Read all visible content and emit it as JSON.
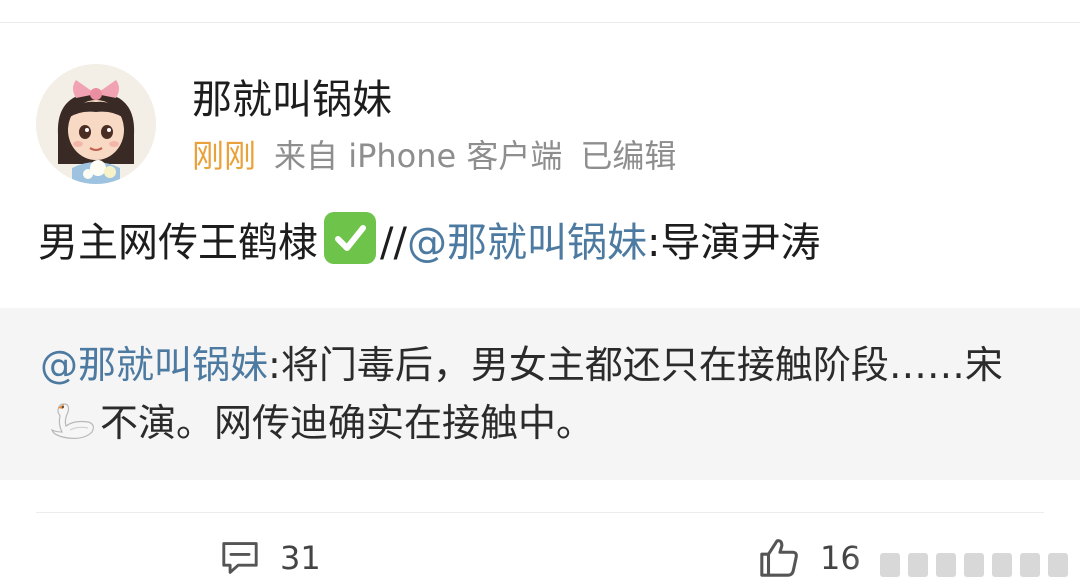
{
  "post": {
    "username": "那就叫锅妹",
    "time": "刚刚",
    "source": "来自 iPhone 客户端",
    "edited": "已编辑",
    "text_before": "男主网传王鹤棣",
    "check_icon": "check-mark-button-emoji",
    "separator": "//",
    "mention": "@那就叫锅妹",
    "text_after": ":导演尹涛"
  },
  "repost": {
    "mention": "@那就叫锅妹",
    "text_part1": ":将门毒后，男女主都还只在接触阶段……宋",
    "swan_icon": "swan-emoji",
    "text_part2": "不演。网传迪确实在接触中。"
  },
  "actions": {
    "comment_count": "31",
    "like_count": "16"
  },
  "colors": {
    "time": "#e9a13b",
    "mention": "#4d7aa1",
    "meta": "#8e8e8e",
    "repost_bg": "#f5f5f5",
    "check_bg": "#6ec34a"
  }
}
